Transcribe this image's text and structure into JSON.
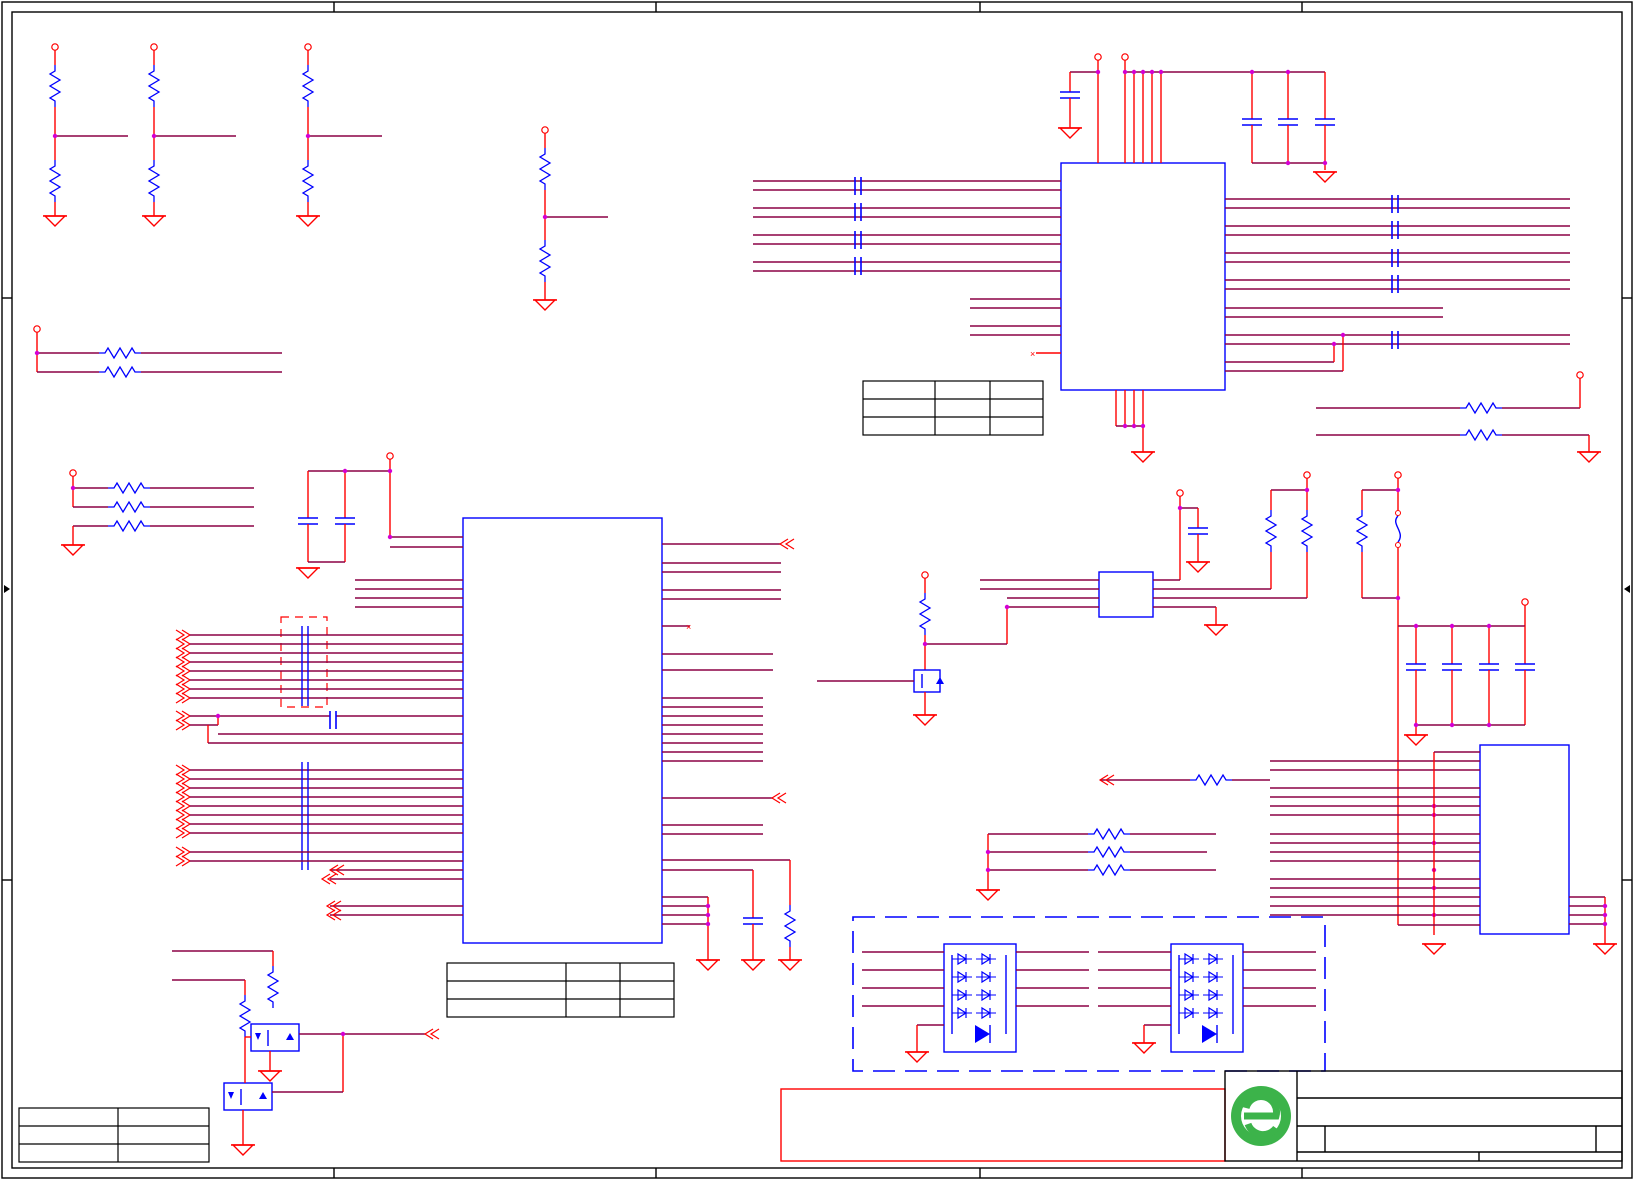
{
  "schematic": {
    "colors": {
      "wire": "#ff0000",
      "bus": "#8b0045",
      "symbol": "#0000ff",
      "junction": "#d400d4",
      "frame": "#000000",
      "logo": "#3cb34a"
    },
    "icons": [
      "resistor-icon",
      "capacitor-icon",
      "ground-icon",
      "power-port-icon",
      "mosfet-icon",
      "tvs-diode-array-icon",
      "company-logo-icon"
    ],
    "components": {
      "main_ic": "ic-u1",
      "top_ic": "ic-u2",
      "small_ic": "ic-u3",
      "connector": "connector-j1",
      "esd_arrays": 2
    }
  }
}
